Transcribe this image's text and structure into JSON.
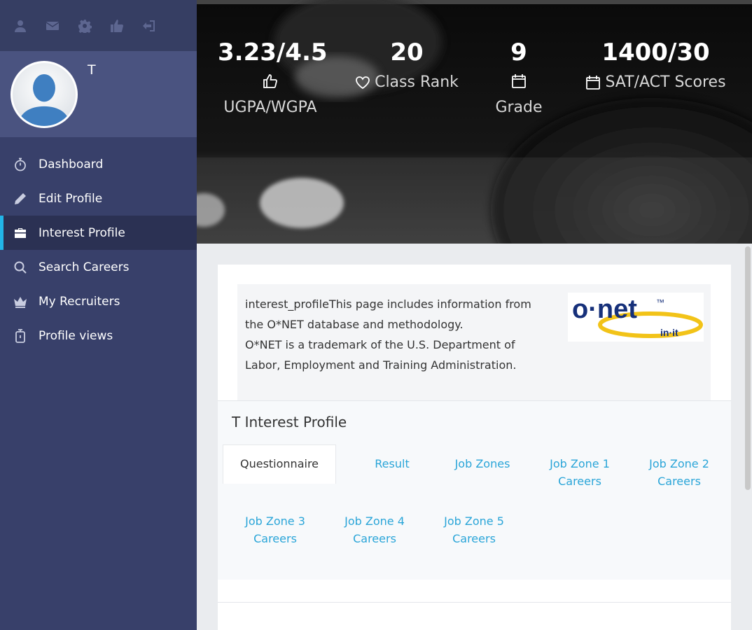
{
  "sidebar": {
    "top_icons": [
      "user-icon",
      "envelope-icon",
      "gear-icon",
      "thumbs-up-icon",
      "sign-out-icon"
    ],
    "profile": {
      "name": "T"
    },
    "nav": [
      {
        "label": "Dashboard",
        "icon": "stopwatch-icon"
      },
      {
        "label": "Edit Profile",
        "icon": "pencil-icon"
      },
      {
        "label": "Interest Profile",
        "icon": "briefcase-icon",
        "active": true
      },
      {
        "label": "Search Careers",
        "icon": "search-icon"
      },
      {
        "label": "My Recruiters",
        "icon": "crown-icon"
      },
      {
        "label": "Profile views",
        "icon": "timer-icon"
      }
    ]
  },
  "stats": {
    "gpa": {
      "value": "3.23/4.5",
      "sub": "UGPA/WGPA",
      "icon": "thumbs-up-icon"
    },
    "rank": {
      "value": "20",
      "label": "Class Rank",
      "icon": "heart-icon"
    },
    "grade": {
      "value": "9",
      "sub": "Grade",
      "icon": "calendar-icon"
    },
    "scores": {
      "value": "1400/30",
      "label": "SAT/ACT Scores",
      "icon": "calendar-icon"
    }
  },
  "onet": {
    "line1": "interest_profileThis page includes information from",
    "line2": "the O*NET database and methodology.",
    "line3": "O*NET is a trademark of the U.S. Department of",
    "line4": "Labor, Employment and Training Administration.",
    "logo_word": "o·net",
    "logo_tm": "™",
    "logo_sub": "in·it"
  },
  "interest_profile": {
    "title": "T Interest Profile",
    "tabs": [
      {
        "line1": "Questionnaire",
        "line2": ""
      },
      {
        "line1": "Result",
        "line2": ""
      },
      {
        "line1": "Job Zones",
        "line2": ""
      },
      {
        "line1": "Job Zone 1",
        "line2": "Careers"
      },
      {
        "line1": "Job Zone 2",
        "line2": "Careers"
      },
      {
        "line1": "Job Zone 3",
        "line2": "Careers"
      },
      {
        "line1": "Job Zone 4",
        "line2": "Careers"
      },
      {
        "line1": "Job Zone 5",
        "line2": "Careers"
      }
    ]
  },
  "colors": {
    "sidebar_bg": "#38406a",
    "profile_bg": "#4a5380",
    "active_nav_bg": "#2b3153",
    "accent": "#22b5e8",
    "link": "#2aa5d8"
  }
}
